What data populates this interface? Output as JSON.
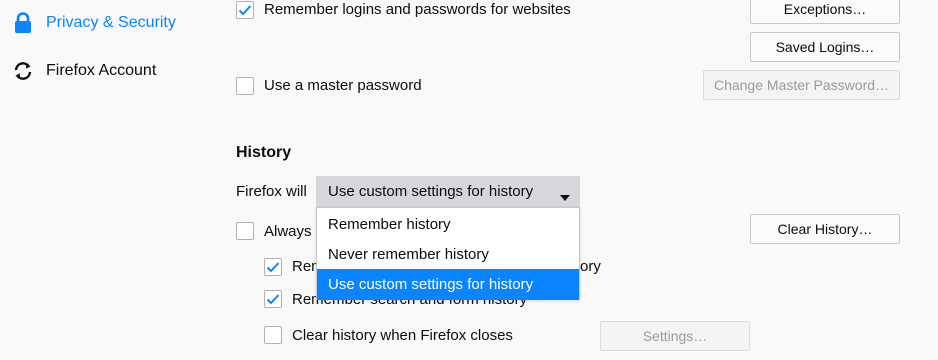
{
  "sidebar": {
    "items": [
      {
        "label": "Privacy & Security",
        "icon": "lock-icon",
        "selected": true
      },
      {
        "label": "Firefox Account",
        "icon": "sync-icon",
        "selected": false
      }
    ]
  },
  "logins": {
    "remember_label": "Remember logins and passwords for websites",
    "remember_checked": true,
    "exceptions_button": "Exceptions…",
    "saved_logins_button": "Saved Logins…",
    "master_password_label": "Use a master password",
    "master_password_checked": false,
    "change_master_button": "Change Master Password…"
  },
  "history": {
    "title": "History",
    "firefox_will_label": "Firefox will",
    "select_value": "Use custom settings for history",
    "options": [
      "Remember history",
      "Never remember history",
      "Use custom settings for history"
    ],
    "selected_option_index": 2,
    "always_private_label_visible": "Always u",
    "clear_history_button": "Clear History…",
    "remember_browsing_label_visible_start": "Rem",
    "remember_browsing_label_visible_end": "ory",
    "remember_browsing_checked": true,
    "remember_search_label": "Remember search and form history",
    "remember_search_checked": true,
    "clear_on_close_label": "Clear history when Firefox closes",
    "clear_on_close_checked": false,
    "settings_button": "Settings…"
  },
  "colors": {
    "accent": "#0a84ff",
    "background": "#f9f9fa",
    "select_bg": "#d7d7db"
  }
}
